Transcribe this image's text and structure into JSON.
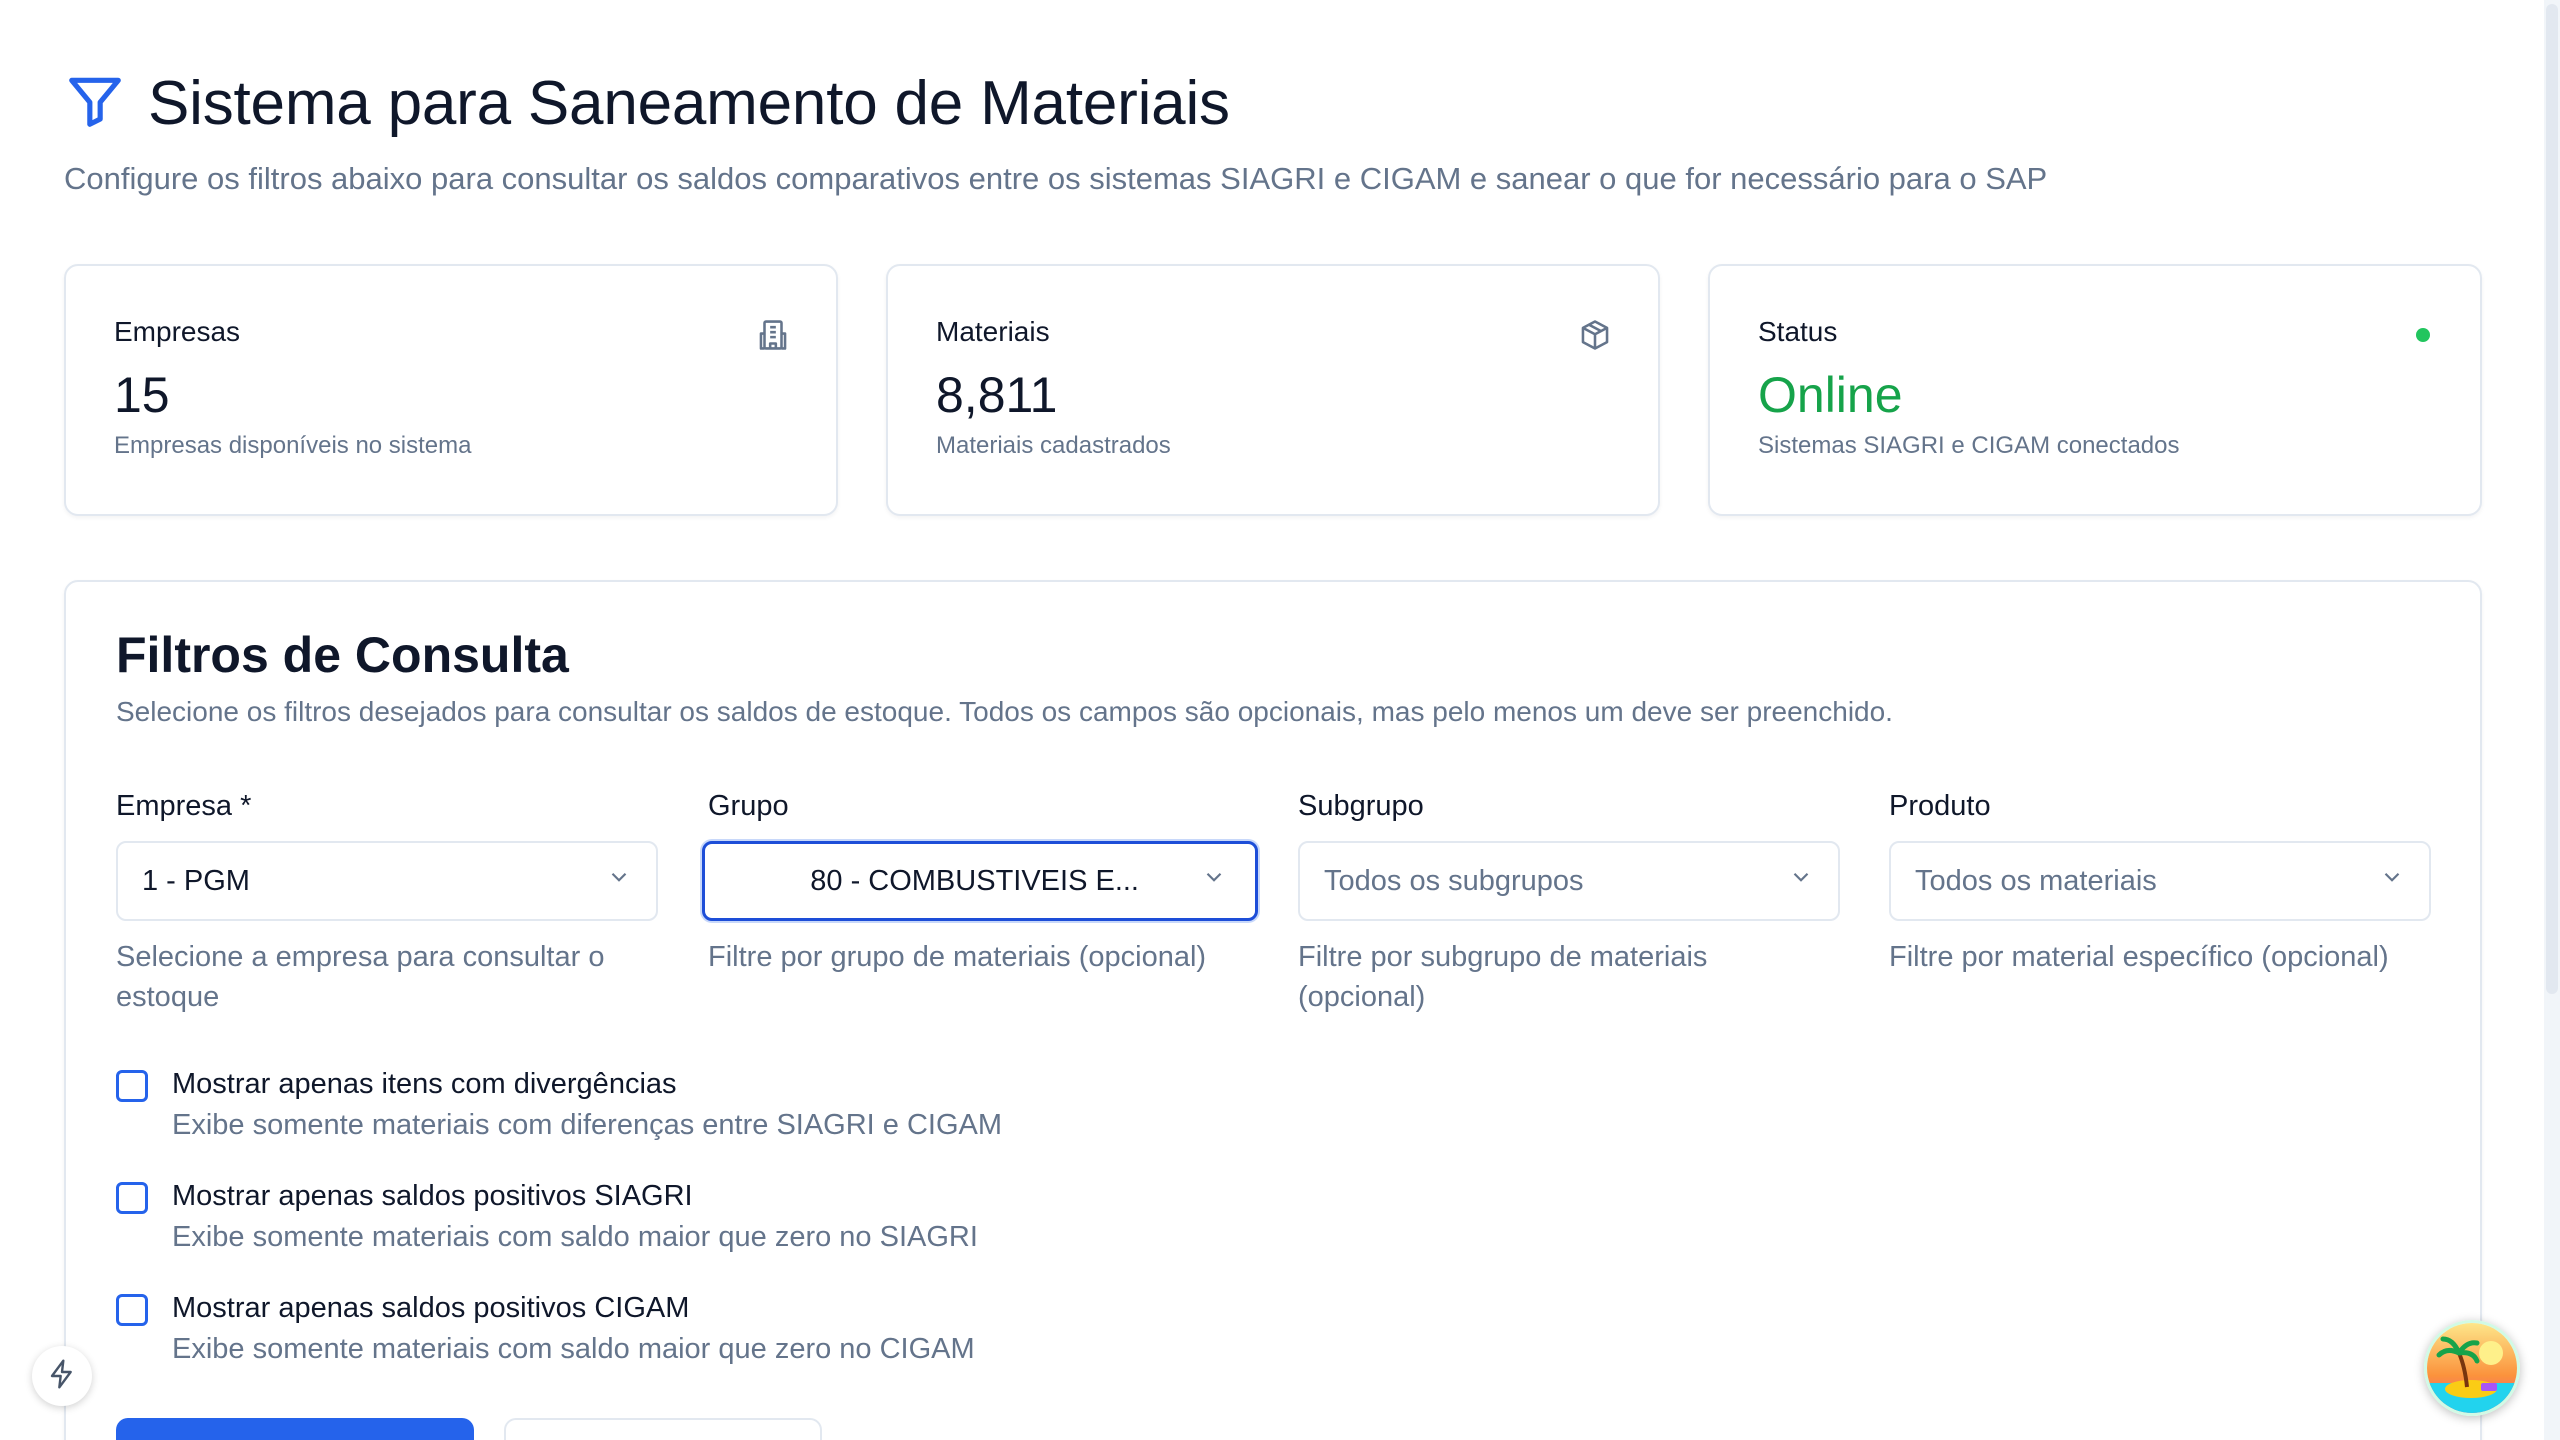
{
  "header": {
    "title": "Sistema para Saneamento de Materiais",
    "subtitle": "Configure os filtros abaixo para consultar os saldos comparativos entre os sistemas SIAGRI e CIGAM e sanear o que for necessário para o SAP",
    "icon": "filter-icon"
  },
  "cards": [
    {
      "label": "Empresas",
      "value": "15",
      "description": "Empresas disponíveis no sistema",
      "icon": "building-icon"
    },
    {
      "label": "Materiais",
      "value": "8,811",
      "description": "Materiais cadastrados",
      "icon": "package-icon"
    },
    {
      "label": "Status",
      "value": "Online",
      "description": "Sistemas SIAGRI e CIGAM conectados",
      "icon": "status-dot",
      "value_color": "#16a34a"
    }
  ],
  "filters": {
    "title": "Filtros de Consulta",
    "description": "Selecione os filtros desejados para consultar os saldos de estoque. Todos os campos são opcionais, mas pelo menos um deve ser preenchido.",
    "fields": [
      {
        "label": "Empresa *",
        "value": "1 - PGM",
        "help": "Selecione a empresa para consultar o estoque"
      },
      {
        "label": "Grupo",
        "value": "80 - COMBUSTIVEIS E...",
        "help": "Filtre por grupo de materiais (opcional)"
      },
      {
        "label": "Subgrupo",
        "placeholder": "Todos os subgrupos",
        "help": "Filtre por subgrupo de materiais (opcional)"
      },
      {
        "label": "Produto",
        "placeholder": "Todos os materiais",
        "help": "Filtre por material específico (opcional)"
      }
    ],
    "checkboxes": [
      {
        "label": "Mostrar apenas itens com divergências",
        "description": "Exibe somente materiais com diferenças entre SIAGRI e CIGAM",
        "checked": false
      },
      {
        "label": "Mostrar apenas saldos positivos SIAGRI",
        "description": "Exibe somente materiais com saldo maior que zero no SIAGRI",
        "checked": false
      },
      {
        "label": "Mostrar apenas saldos positivos CIGAM",
        "description": "Exibe somente materiais com saldo maior que zero no CIGAM",
        "checked": false
      }
    ]
  },
  "colors": {
    "accent": "#2563eb",
    "online": "#16a34a",
    "muted_text": "#64748b",
    "border": "#e2e8f0"
  }
}
